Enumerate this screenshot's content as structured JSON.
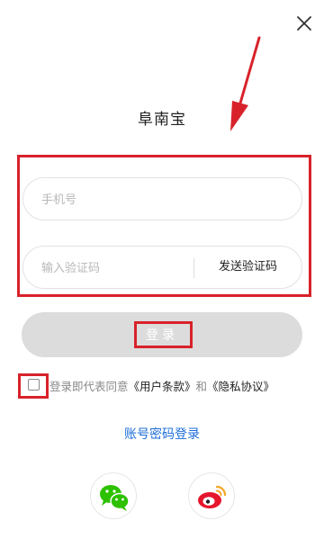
{
  "header": {
    "close_icon": "close-icon",
    "title": "阜南宝"
  },
  "form": {
    "phone_placeholder": "手机号",
    "code_placeholder": "输入验证码",
    "send_code_label": "发送验证码",
    "login_label": "登录"
  },
  "agreement": {
    "checked": false,
    "prefix": "登录即代表同意",
    "terms_link": "《用户条款》",
    "and": "和",
    "privacy_link": "《隐私协议》"
  },
  "alt_login": {
    "password_login_label": "账号密码登录"
  },
  "social": {
    "wechat_icon": "wechat-icon",
    "weibo_icon": "weibo-icon"
  },
  "colors": {
    "highlight": "#d8222a",
    "link_blue": "#1e6ed8",
    "button_disabled": "#dcdcdc",
    "wechat_green": "#2dc100",
    "weibo_red": "#e6162d",
    "weibo_orange": "#f5a623"
  }
}
